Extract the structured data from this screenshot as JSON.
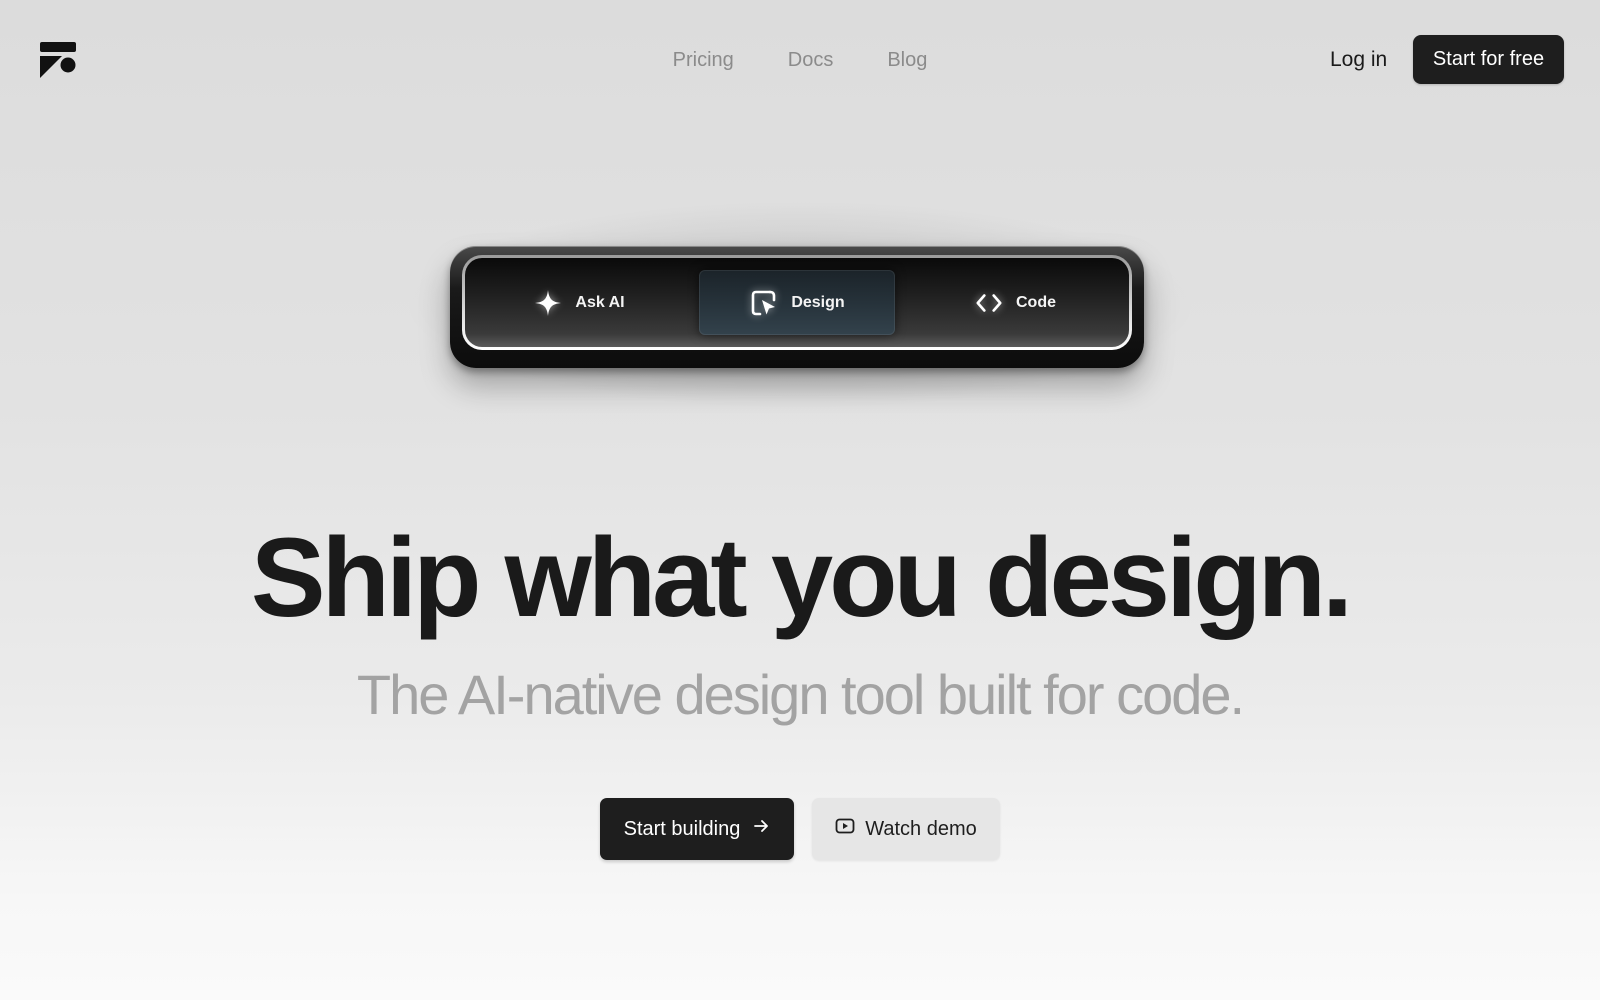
{
  "brand": {
    "logo_icon": "brand-logo-icon",
    "logo_color": "#111111"
  },
  "nav": {
    "items": [
      {
        "label": "Pricing"
      },
      {
        "label": "Docs"
      },
      {
        "label": "Blog"
      }
    ]
  },
  "header": {
    "login_label": "Log in",
    "cta_label": "Start for free"
  },
  "toolbar": {
    "active": "Design",
    "segments": [
      {
        "label": "Ask AI",
        "icon": "sparkle-icon"
      },
      {
        "label": "Design",
        "icon": "cursor-frame-icon"
      },
      {
        "label": "Code",
        "icon": "code-brackets-icon"
      }
    ]
  },
  "hero": {
    "headline": "Ship what you design.",
    "subheadline": "The AI-native design tool built for code.",
    "primary_button": {
      "label": "Start building",
      "icon": "arrow-right-icon"
    },
    "secondary_button": {
      "label": "Watch demo",
      "icon": "play-icon"
    }
  },
  "colors": {
    "primary": "#1e1e1e",
    "muted_text": "#8b8b8b",
    "subheadline": "#a3a3a3",
    "secondary_button_bg": "#e6e6e6"
  }
}
